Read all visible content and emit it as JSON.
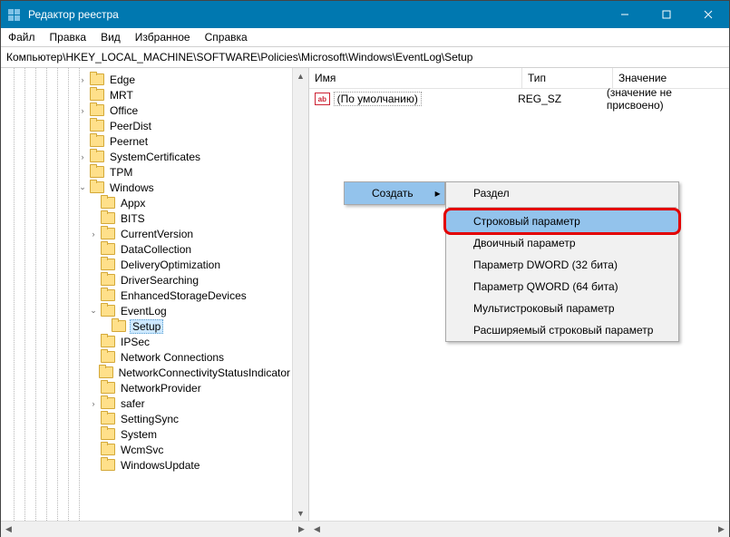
{
  "window": {
    "title": "Редактор реестра"
  },
  "menubar": [
    "Файл",
    "Правка",
    "Вид",
    "Избранное",
    "Справка"
  ],
  "address": "Компьютер\\HKEY_LOCAL_MACHINE\\SOFTWARE\\Policies\\Microsoft\\Windows\\EventLog\\Setup",
  "tree": [
    {
      "d": 7,
      "t": "r",
      "n": "Edge"
    },
    {
      "d": 7,
      "t": "",
      "n": "MRT"
    },
    {
      "d": 7,
      "t": "r",
      "n": "Office"
    },
    {
      "d": 7,
      "t": "",
      "n": "PeerDist"
    },
    {
      "d": 7,
      "t": "",
      "n": "Peernet"
    },
    {
      "d": 7,
      "t": "r",
      "n": "SystemCertificates"
    },
    {
      "d": 7,
      "t": "",
      "n": "TPM"
    },
    {
      "d": 7,
      "t": "d",
      "n": "Windows"
    },
    {
      "d": 8,
      "t": "",
      "n": "Appx"
    },
    {
      "d": 8,
      "t": "",
      "n": "BITS"
    },
    {
      "d": 8,
      "t": "r",
      "n": "CurrentVersion"
    },
    {
      "d": 8,
      "t": "",
      "n": "DataCollection"
    },
    {
      "d": 8,
      "t": "",
      "n": "DeliveryOptimization"
    },
    {
      "d": 8,
      "t": "",
      "n": "DriverSearching"
    },
    {
      "d": 8,
      "t": "",
      "n": "EnhancedStorageDevices"
    },
    {
      "d": 8,
      "t": "d",
      "n": "EventLog"
    },
    {
      "d": 9,
      "t": "",
      "n": "Setup",
      "sel": true
    },
    {
      "d": 8,
      "t": "",
      "n": "IPSec"
    },
    {
      "d": 8,
      "t": "",
      "n": "Network Connections"
    },
    {
      "d": 8,
      "t": "",
      "n": "NetworkConnectivityStatusIndicator"
    },
    {
      "d": 8,
      "t": "",
      "n": "NetworkProvider"
    },
    {
      "d": 8,
      "t": "r",
      "n": "safer"
    },
    {
      "d": 8,
      "t": "",
      "n": "SettingSync"
    },
    {
      "d": 8,
      "t": "",
      "n": "System"
    },
    {
      "d": 8,
      "t": "",
      "n": "WcmSvc"
    },
    {
      "d": 8,
      "t": "",
      "n": "WindowsUpdate"
    }
  ],
  "list": {
    "columns": [
      "Имя",
      "Тип",
      "Значение"
    ],
    "rows": [
      {
        "name": "(По умолчанию)",
        "type": "REG_SZ",
        "value": "(значение не присвоено)"
      }
    ]
  },
  "context": {
    "parent": "Создать",
    "items": [
      "Раздел",
      "Строковый параметр",
      "Двоичный параметр",
      "Параметр DWORD (32 бита)",
      "Параметр QWORD (64 бита)",
      "Мультистроковый параметр",
      "Расширяемый строковый параметр"
    ],
    "highlight_index": 1
  }
}
